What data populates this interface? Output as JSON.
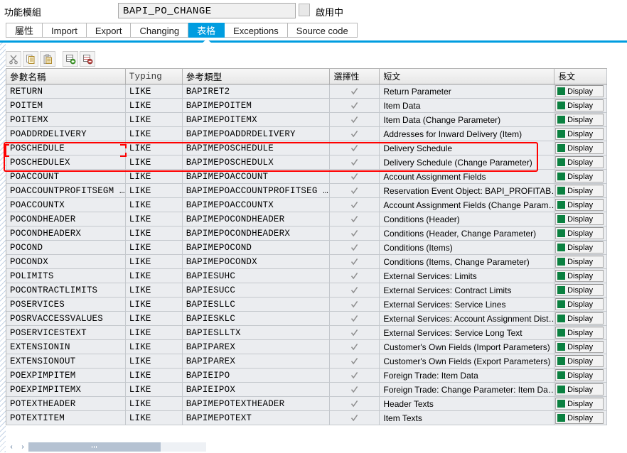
{
  "header": {
    "label": "功能模組",
    "function_module": "BAPI_PO_CHANGE",
    "status": "啟用中"
  },
  "tabs": [
    {
      "label": "屬性",
      "active": false
    },
    {
      "label": "Import",
      "active": false
    },
    {
      "label": "Export",
      "active": false
    },
    {
      "label": "Changing",
      "active": false
    },
    {
      "label": "表格",
      "active": true
    },
    {
      "label": "Exceptions",
      "active": false
    },
    {
      "label": "Source code",
      "active": false
    }
  ],
  "toolbar": [
    {
      "name": "cut-icon",
      "title": "Cut"
    },
    {
      "name": "copy-icon",
      "title": "Copy"
    },
    {
      "name": "paste-icon",
      "title": "Paste"
    },
    {
      "name": "insert-row-icon",
      "title": "Insert Row"
    },
    {
      "name": "delete-row-icon",
      "title": "Delete Row"
    }
  ],
  "table": {
    "columns": [
      "參數名稱",
      "Typing",
      "參考類型",
      "選擇性",
      "短文",
      "長文"
    ],
    "long_text_button_label": "Display",
    "rows": [
      {
        "name": "RETURN",
        "typing": "LIKE",
        "ref": "BAPIRET2",
        "optional": true,
        "short": "Return Parameter"
      },
      {
        "name": "POITEM",
        "typing": "LIKE",
        "ref": "BAPIMEPOITEM",
        "optional": true,
        "short": "Item Data"
      },
      {
        "name": "POITEMX",
        "typing": "LIKE",
        "ref": "BAPIMEPOITEMX",
        "optional": true,
        "short": "Item Data (Change Parameter)"
      },
      {
        "name": "POADDRDELIVERY",
        "typing": "LIKE",
        "ref": "BAPIMEPOADDRDELIVERY",
        "optional": true,
        "short": "Addresses for Inward Delivery (Item)"
      },
      {
        "name": "POSCHEDULE",
        "typing": "LIKE",
        "ref": "BAPIMEPOSCHEDULE",
        "optional": true,
        "short": "Delivery Schedule"
      },
      {
        "name": "POSCHEDULEX",
        "typing": "LIKE",
        "ref": "BAPIMEPOSCHEDULX",
        "optional": true,
        "short": "Delivery Schedule (Change Parameter)"
      },
      {
        "name": "POACCOUNT",
        "typing": "LIKE",
        "ref": "BAPIMEPOACCOUNT",
        "optional": true,
        "short": "Account Assignment Fields"
      },
      {
        "name": "POACCOUNTPROFITSEGM …",
        "typing": "LIKE",
        "ref": "BAPIMEPOACCOUNTPROFITSEG …",
        "optional": true,
        "short": "Reservation Event Object: BAPI_PROFITAB…"
      },
      {
        "name": "POACCOUNTX",
        "typing": "LIKE",
        "ref": "BAPIMEPOACCOUNTX",
        "optional": true,
        "short": "Account Assignment Fields (Change Param…"
      },
      {
        "name": "POCONDHEADER",
        "typing": "LIKE",
        "ref": "BAPIMEPOCONDHEADER",
        "optional": true,
        "short": "Conditions (Header)"
      },
      {
        "name": "POCONDHEADERX",
        "typing": "LIKE",
        "ref": "BAPIMEPOCONDHEADERX",
        "optional": true,
        "short": "Conditions (Header, Change Parameter)"
      },
      {
        "name": "POCOND",
        "typing": "LIKE",
        "ref": "BAPIMEPOCOND",
        "optional": true,
        "short": "Conditions (Items)"
      },
      {
        "name": "POCONDX",
        "typing": "LIKE",
        "ref": "BAPIMEPOCONDX",
        "optional": true,
        "short": "Conditions (Items, Change Parameter)"
      },
      {
        "name": "POLIMITS",
        "typing": "LIKE",
        "ref": "BAPIESUHC",
        "optional": true,
        "short": "External Services: Limits"
      },
      {
        "name": "POCONTRACTLIMITS",
        "typing": "LIKE",
        "ref": "BAPIESUCC",
        "optional": true,
        "short": "External Services: Contract Limits"
      },
      {
        "name": "POSERVICES",
        "typing": "LIKE",
        "ref": "BAPIESLLC",
        "optional": true,
        "short": "External Services: Service Lines"
      },
      {
        "name": "POSRVACCESSVALUES",
        "typing": "LIKE",
        "ref": "BAPIESKLC",
        "optional": true,
        "short": "External Services: Account Assignment Dist…"
      },
      {
        "name": "POSERVICESTEXT",
        "typing": "LIKE",
        "ref": "BAPIESLLTX",
        "optional": true,
        "short": "External Services: Service Long Text"
      },
      {
        "name": "EXTENSIONIN",
        "typing": "LIKE",
        "ref": "BAPIPAREX",
        "optional": true,
        "short": "Customer's Own Fields (Import Parameters)"
      },
      {
        "name": "EXTENSIONOUT",
        "typing": "LIKE",
        "ref": "BAPIPAREX",
        "optional": true,
        "short": "Customer's Own Fields (Export Parameters)"
      },
      {
        "name": "POEXPIMPITEM",
        "typing": "LIKE",
        "ref": "BAPIEIPO",
        "optional": true,
        "short": "Foreign Trade: Item Data"
      },
      {
        "name": "POEXPIMPITEMX",
        "typing": "LIKE",
        "ref": "BAPIEIPOX",
        "optional": true,
        "short": "Foreign Trade: Change Parameter: Item Da…"
      },
      {
        "name": "POTEXTHEADER",
        "typing": "LIKE",
        "ref": "BAPIMEPOTEXTHEADER",
        "optional": true,
        "short": "Header Texts"
      },
      {
        "name": "POTEXTITEM",
        "typing": "LIKE",
        "ref": "BAPIMEPOTEXT",
        "optional": true,
        "short": "Item Texts"
      }
    ]
  },
  "annotation": {
    "highlight_rows": [
      "POSCHEDULE",
      "POSCHEDULEX"
    ],
    "color": "#ff0000"
  },
  "scrollbar": {
    "left_arrow": "‹",
    "right_arrow": "›"
  },
  "colors": {
    "accent": "#009de0",
    "display_square": "#0a8040",
    "row_background": "#ebedf0",
    "annotation": "#ff0000"
  }
}
